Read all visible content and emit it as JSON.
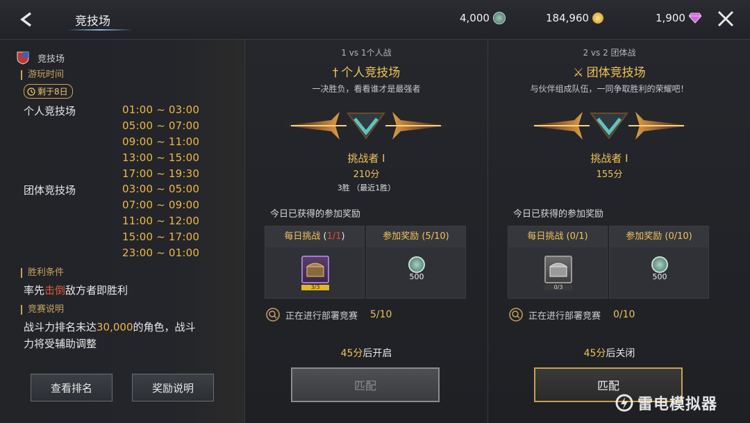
{
  "header": {
    "title": "竞技场",
    "currencies": [
      {
        "value": "4,000",
        "icon": "medal-icon"
      },
      {
        "value": "184,960",
        "icon": "gold-coin-icon"
      },
      {
        "value": "1,900",
        "icon": "diamond-icon"
      }
    ]
  },
  "left": {
    "heading": "竞技场",
    "play_time_label": "游玩时间",
    "remaining": "剩于8日",
    "schedule": [
      {
        "name": "个人竞技场",
        "times": [
          "01:00 ~ 03:00",
          "05:00 ~ 07:00",
          "09:00 ~ 11:00",
          "13:00 ~ 15:00",
          "17:00 ~ 19:30"
        ]
      },
      {
        "name": "团体竞技场",
        "times": [
          "03:00 ~ 05:00",
          "07:00 ~ 09:00",
          "11:00 ~ 12:00",
          "15:00 ~ 17:00",
          "23:00 ~ 01:00"
        ]
      }
    ],
    "win_label": "胜利条件",
    "win_pre": "率先",
    "win_hl": "击倒",
    "win_post": "敌方者即胜利",
    "desc_label": "竞赛说明",
    "desc_pre": "战斗力排名未达",
    "desc_hl": "30,000",
    "desc_post1": "的角色，战斗",
    "desc_line2": "力将受辅助调整",
    "btn_rank": "查看排名",
    "btn_reward": "奖励说明"
  },
  "solo": {
    "subtitle": "1 vs 1个人战",
    "title": "个人竞技场",
    "desc": "一决胜负，看看谁才是最强者",
    "rank": "挑战者 I",
    "score": "210分",
    "record": "3胜 （最近1胜）",
    "reward_title": "今日已获得的参加奖励",
    "daily_label": "每日挑战",
    "daily_count": "1/1",
    "join_label": "参加奖励 (5/10)",
    "chest_count": "3/3",
    "coin_amount": "500",
    "progress_label": "正在进行部署竞赛",
    "progress_value": "5/10",
    "timer_num": "45分",
    "timer_text": "后开启",
    "match_label": "匹配"
  },
  "team": {
    "subtitle": "2 vs 2 团体战",
    "title": "团体竞技场",
    "desc": "与伙伴组成队伍，一同争取胜利的荣耀吧！",
    "rank": "挑战者 I",
    "score": "155分",
    "reward_title": "今日已获得的参加奖励",
    "daily_label": "每日挑战 (0/1)",
    "join_label": "参加奖励 (0/10)",
    "chest_count": "0/3",
    "coin_amount": "500",
    "progress_label": "正在进行部署竞赛",
    "progress_value": "0/10",
    "timer_num": "45分",
    "timer_text": "后关闭",
    "match_label": "匹配"
  },
  "watermark": "雷电模拟器"
}
